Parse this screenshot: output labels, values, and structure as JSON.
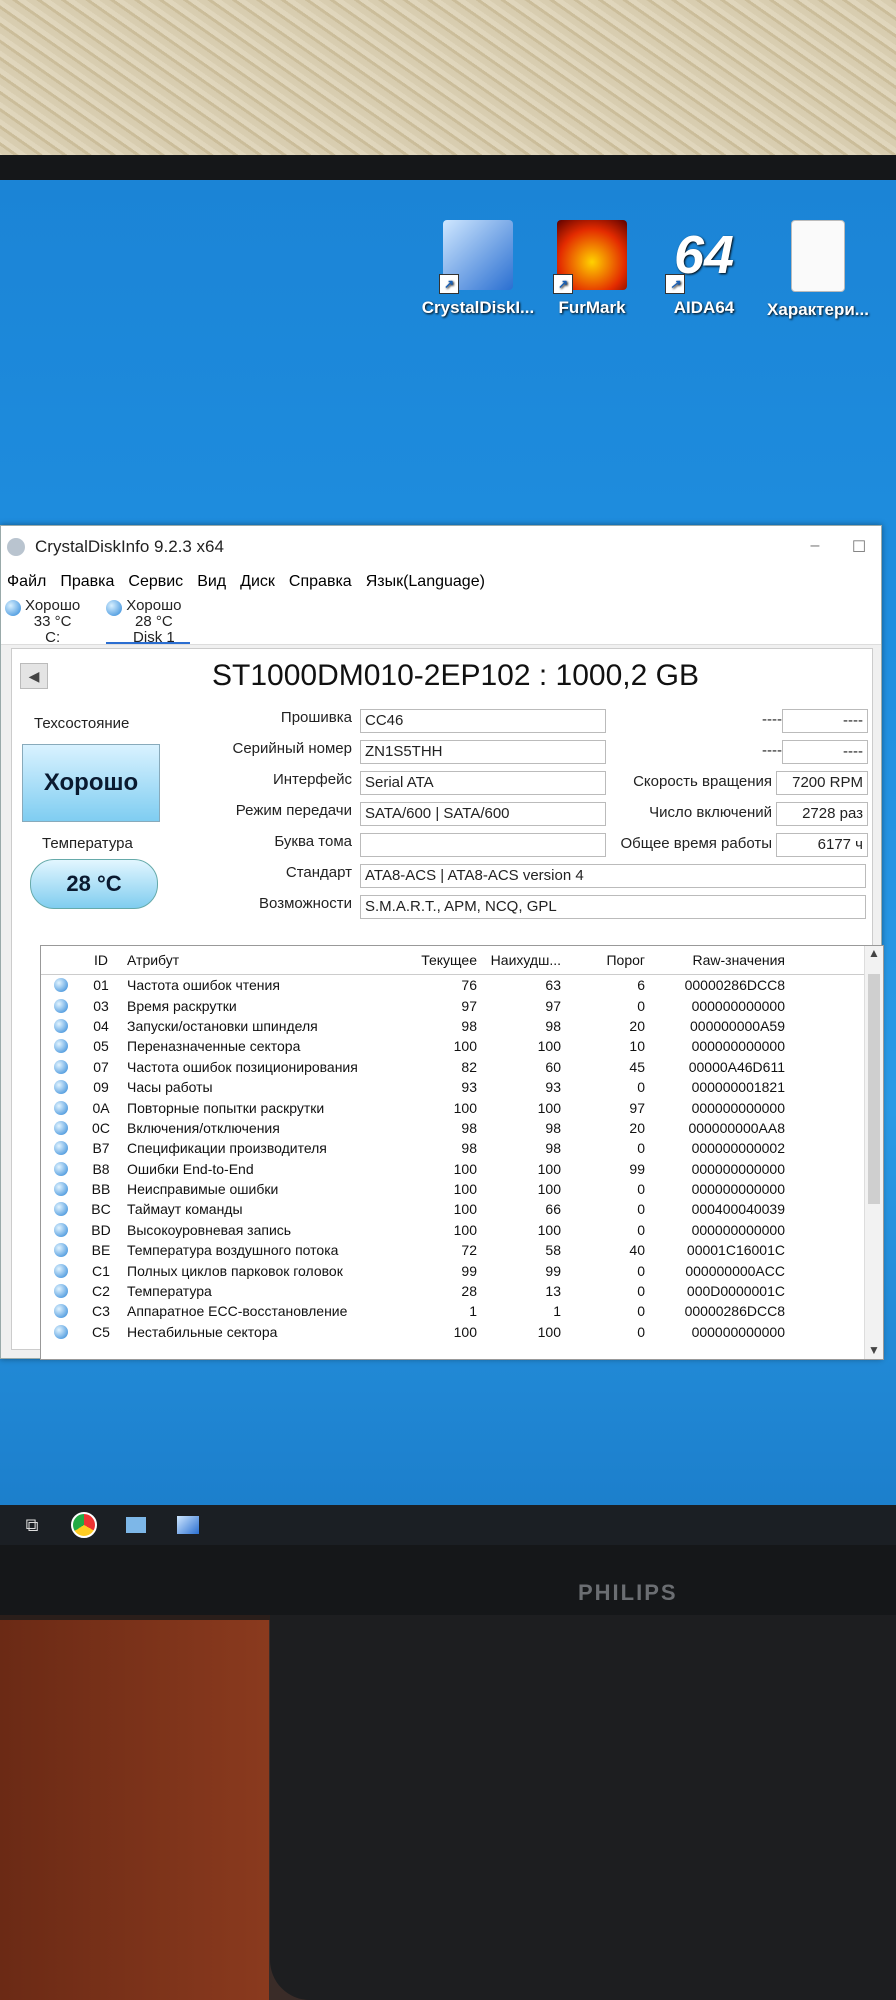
{
  "desktop": {
    "icons": [
      {
        "label": "CrystalDiskI...",
        "icon": "crystaldiskinfo-icon"
      },
      {
        "label": "FurMark",
        "icon": "furmark-icon"
      },
      {
        "label": "AIDA64",
        "icon": "aida64-icon"
      },
      {
        "label": "Характери...",
        "icon": "document-icon"
      }
    ]
  },
  "window": {
    "title": "CrystalDiskInfo 9.2.3 x64",
    "menu": [
      "Файл",
      "Правка",
      "Сервис",
      "Вид",
      "Диск",
      "Справка",
      "Язык(Language)"
    ],
    "disks": [
      {
        "status": "Хорошо",
        "temp": "33 °C",
        "name": "C:"
      },
      {
        "status": "Хорошо",
        "temp": "28 °C",
        "name": "Disk 1"
      }
    ],
    "model": "ST1000DM010-2EP102 : 1000,2 GB",
    "health_label": "Техсостояние",
    "health_value": "Хорошо",
    "temp_label": "Температура",
    "temp_value": "28 °C",
    "info": {
      "firmware_label": "Прошивка",
      "firmware": "CC46",
      "serial_label": "Серийный номер",
      "serial": "ZN1S5THH",
      "interface_label": "Интерфейс",
      "interface": "Serial ATA",
      "transfer_label": "Режим передачи",
      "transfer": "SATA/600 | SATA/600",
      "drive_letter_label": "Буква тома",
      "drive_letter": "",
      "standard_label": "Стандарт",
      "standard": "ATA8-ACS | ATA8-ACS version 4",
      "features_label": "Возможности",
      "features": "S.M.A.R.T., APM, NCQ, GPL",
      "blank1_label": "----",
      "blank1": "----",
      "blank2_label": "----",
      "blank2": "----",
      "rotation_label": "Скорость вращения",
      "rotation": "7200 RPM",
      "power_count_label": "Число включений",
      "power_count": "2728 раз",
      "power_hours_label": "Общее время работы",
      "power_hours": "6177 ч"
    },
    "smart": {
      "headers": {
        "id": "ID",
        "name": "Атрибут",
        "current": "Текущее",
        "worst": "Наихудш...",
        "threshold": "Порог",
        "raw": "Raw-значения"
      },
      "rows": [
        {
          "id": "01",
          "name": "Частота ошибок чтения",
          "current": "76",
          "worst": "63",
          "threshold": "6",
          "raw": "00000286DCC8"
        },
        {
          "id": "03",
          "name": "Время раскрутки",
          "current": "97",
          "worst": "97",
          "threshold": "0",
          "raw": "000000000000"
        },
        {
          "id": "04",
          "name": "Запуски/остановки шпинделя",
          "current": "98",
          "worst": "98",
          "threshold": "20",
          "raw": "000000000A59"
        },
        {
          "id": "05",
          "name": "Переназначенные сектора",
          "current": "100",
          "worst": "100",
          "threshold": "10",
          "raw": "000000000000"
        },
        {
          "id": "07",
          "name": "Частота ошибок позиционирования",
          "current": "82",
          "worst": "60",
          "threshold": "45",
          "raw": "00000A46D611"
        },
        {
          "id": "09",
          "name": "Часы работы",
          "current": "93",
          "worst": "93",
          "threshold": "0",
          "raw": "000000001821"
        },
        {
          "id": "0A",
          "name": "Повторные попытки раскрутки",
          "current": "100",
          "worst": "100",
          "threshold": "97",
          "raw": "000000000000"
        },
        {
          "id": "0C",
          "name": "Включения/отключения",
          "current": "98",
          "worst": "98",
          "threshold": "20",
          "raw": "000000000AA8"
        },
        {
          "id": "B7",
          "name": "Спецификации производителя",
          "current": "98",
          "worst": "98",
          "threshold": "0",
          "raw": "000000000002"
        },
        {
          "id": "B8",
          "name": "Ошибки End-to-End",
          "current": "100",
          "worst": "100",
          "threshold": "99",
          "raw": "000000000000"
        },
        {
          "id": "BB",
          "name": "Неисправимые ошибки",
          "current": "100",
          "worst": "100",
          "threshold": "0",
          "raw": "000000000000"
        },
        {
          "id": "BC",
          "name": "Таймаут команды",
          "current": "100",
          "worst": "66",
          "threshold": "0",
          "raw": "000400040039"
        },
        {
          "id": "BD",
          "name": "Высокоуровневая запись",
          "current": "100",
          "worst": "100",
          "threshold": "0",
          "raw": "000000000000"
        },
        {
          "id": "BE",
          "name": "Температура воздушного потока",
          "current": "72",
          "worst": "58",
          "threshold": "40",
          "raw": "00001C16001C"
        },
        {
          "id": "C1",
          "name": "Полных циклов парковок головок",
          "current": "99",
          "worst": "99",
          "threshold": "0",
          "raw": "000000000ACC"
        },
        {
          "id": "C2",
          "name": "Температура",
          "current": "28",
          "worst": "13",
          "threshold": "0",
          "raw": "000D0000001C"
        },
        {
          "id": "C3",
          "name": "Аппаратное ECC-восстановление",
          "current": "1",
          "worst": "1",
          "threshold": "0",
          "raw": "00000286DCC8"
        },
        {
          "id": "C5",
          "name": "Нестабильные сектора",
          "current": "100",
          "worst": "100",
          "threshold": "0",
          "raw": "000000000000"
        }
      ]
    }
  },
  "monitor": {
    "brand": "PHILIPS"
  }
}
